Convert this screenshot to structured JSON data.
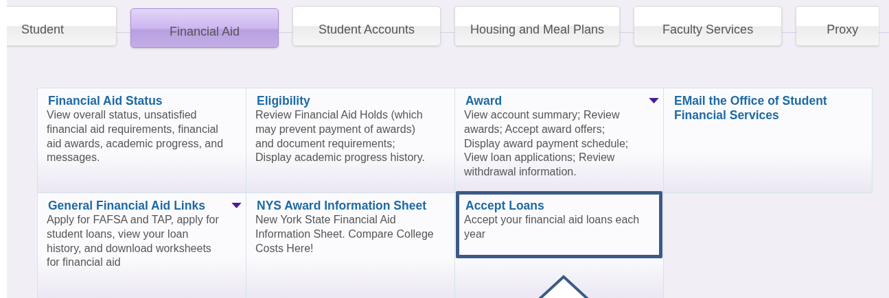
{
  "tabs": [
    {
      "label": "Student",
      "selected": false
    },
    {
      "label": "Financial Aid",
      "selected": true
    },
    {
      "label": "Student Accounts",
      "selected": false
    },
    {
      "label": "Housing and Meal Plans",
      "selected": false
    },
    {
      "label": "Faculty Services",
      "selected": false
    },
    {
      "label": "Proxy",
      "selected": false
    }
  ],
  "menu_rows": [
    [
      {
        "title": "Financial Aid Status",
        "description": "View overall status, unsatisfied financial aid requirements, financial aid awards, academic progress, and messages.",
        "has_menu": false,
        "highlighted": false
      },
      {
        "title": "Eligibility",
        "description": "Review Financial Aid Holds (which may prevent payment of awards) and document requirements; Display academic progress history.",
        "has_menu": false,
        "highlighted": false
      },
      {
        "title": "Award",
        "description": "View account summary; Review awards; Accept award offers; Display award payment schedule; View loan applications; Review withdrawal information.",
        "has_menu": true,
        "highlighted": false
      },
      {
        "title": "EMail the Office of Student Financial Services",
        "has_menu": false,
        "highlighted": false
      }
    ],
    [
      {
        "title": "General Financial Aid Links",
        "description": "Apply for FAFSA and TAP, apply for student loans, view your loan history, and download worksheets for financial aid",
        "has_menu": true,
        "highlighted": false
      },
      {
        "title": "NYS Award Information Sheet",
        "description": "New York State Financial Aid Information Sheet. Compare College Costs Here!",
        "has_menu": false,
        "highlighted": false
      },
      {
        "title": "Accept Loans",
        "description": "Accept your financial aid loans each year",
        "has_menu": false,
        "highlighted": true
      }
    ]
  ]
}
